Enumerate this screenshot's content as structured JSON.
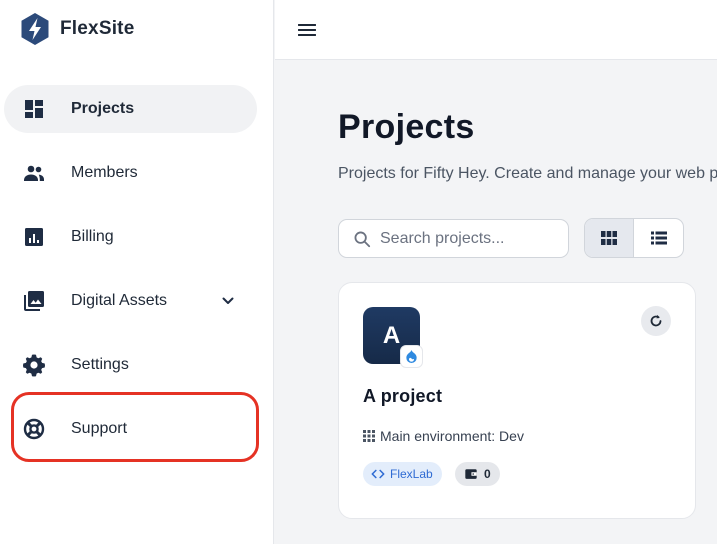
{
  "brand": {
    "name": "FlexSite",
    "accent": "#2c4a7a"
  },
  "sidebar": {
    "items": [
      {
        "label": "Projects",
        "icon": "dashboard-icon",
        "active": true
      },
      {
        "label": "Members",
        "icon": "people-icon"
      },
      {
        "label": "Billing",
        "icon": "bar-chart-icon"
      },
      {
        "label": "Digital Assets",
        "icon": "image-gallery-icon",
        "expandable": true
      },
      {
        "label": "Settings",
        "icon": "gear-icon"
      },
      {
        "label": "Support",
        "icon": "lifebuoy-icon",
        "highlighted": true
      }
    ],
    "highlight_color": "#e53224"
  },
  "topbar": {
    "menu_icon": "hamburger-menu-icon"
  },
  "main": {
    "title": "Projects",
    "subtitle": "Projects for Fifty Hey. Create and manage your web p",
    "search": {
      "placeholder": "Search projects...",
      "value": ""
    },
    "view_toggle": {
      "selected": "grid",
      "options": [
        "grid",
        "list"
      ]
    }
  },
  "projects": [
    {
      "initial": "A",
      "name": "A project",
      "environment": "Main environment: Dev",
      "source_tag": "FlexLab",
      "asset_count": "0",
      "cms_icon": "drupal-icon"
    }
  ]
}
